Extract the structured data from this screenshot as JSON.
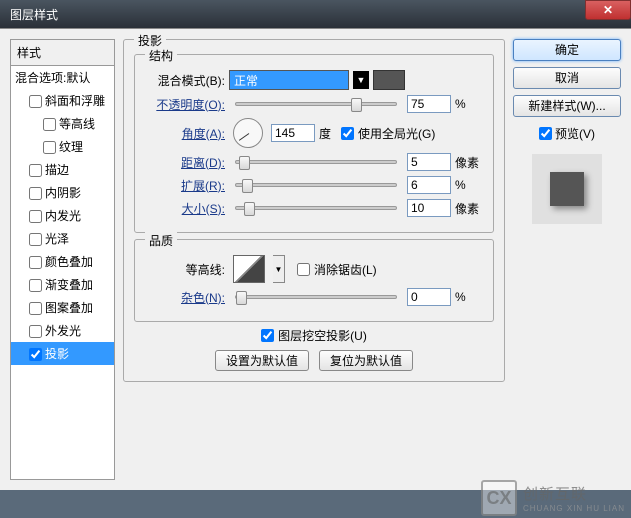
{
  "window": {
    "title": "图层样式"
  },
  "left": {
    "header": "样式",
    "defaults": "混合选项:默认",
    "items": [
      {
        "label": "斜面和浮雕",
        "indent": 1,
        "checked": false
      },
      {
        "label": "等高线",
        "indent": 2,
        "checked": false
      },
      {
        "label": "纹理",
        "indent": 2,
        "checked": false
      },
      {
        "label": "描边",
        "indent": 1,
        "checked": false
      },
      {
        "label": "内阴影",
        "indent": 1,
        "checked": false
      },
      {
        "label": "内发光",
        "indent": 1,
        "checked": false
      },
      {
        "label": "光泽",
        "indent": 1,
        "checked": false
      },
      {
        "label": "颜色叠加",
        "indent": 1,
        "checked": false
      },
      {
        "label": "渐变叠加",
        "indent": 1,
        "checked": false
      },
      {
        "label": "图案叠加",
        "indent": 1,
        "checked": false
      },
      {
        "label": "外发光",
        "indent": 1,
        "checked": false
      },
      {
        "label": "投影",
        "indent": 1,
        "checked": true,
        "selected": true
      }
    ]
  },
  "mid": {
    "title": "投影",
    "structure": {
      "title": "结构",
      "blendModeLabel": "混合模式(B):",
      "blendModeValue": "正常",
      "opacityLabel": "不透明度(O):",
      "opacityValue": "75",
      "opacityUnit": "%",
      "angleLabel": "角度(A):",
      "angleValue": "145",
      "angleUnit": "度",
      "globalLightLabel": "使用全局光(G)",
      "distanceLabel": "距离(D):",
      "distanceValue": "5",
      "distanceUnit": "像素",
      "spreadLabel": "扩展(R):",
      "spreadValue": "6",
      "spreadUnit": "%",
      "sizeLabel": "大小(S):",
      "sizeValue": "10",
      "sizeUnit": "像素"
    },
    "quality": {
      "title": "品质",
      "contourLabel": "等高线:",
      "antialiasLabel": "消除锯齿(L)",
      "noiseLabel": "杂色(N):",
      "noiseValue": "0",
      "noiseUnit": "%"
    },
    "knockoutLabel": "图层挖空投影(U)",
    "setDefault": "设置为默认值",
    "resetDefault": "复位为默认值"
  },
  "right": {
    "ok": "确定",
    "cancel": "取消",
    "newStyle": "新建样式(W)...",
    "previewLabel": "预览(V)"
  },
  "watermark": {
    "logo": "CX",
    "text": "创新互联",
    "sub": "CHUANG XIN HU LIAN"
  }
}
